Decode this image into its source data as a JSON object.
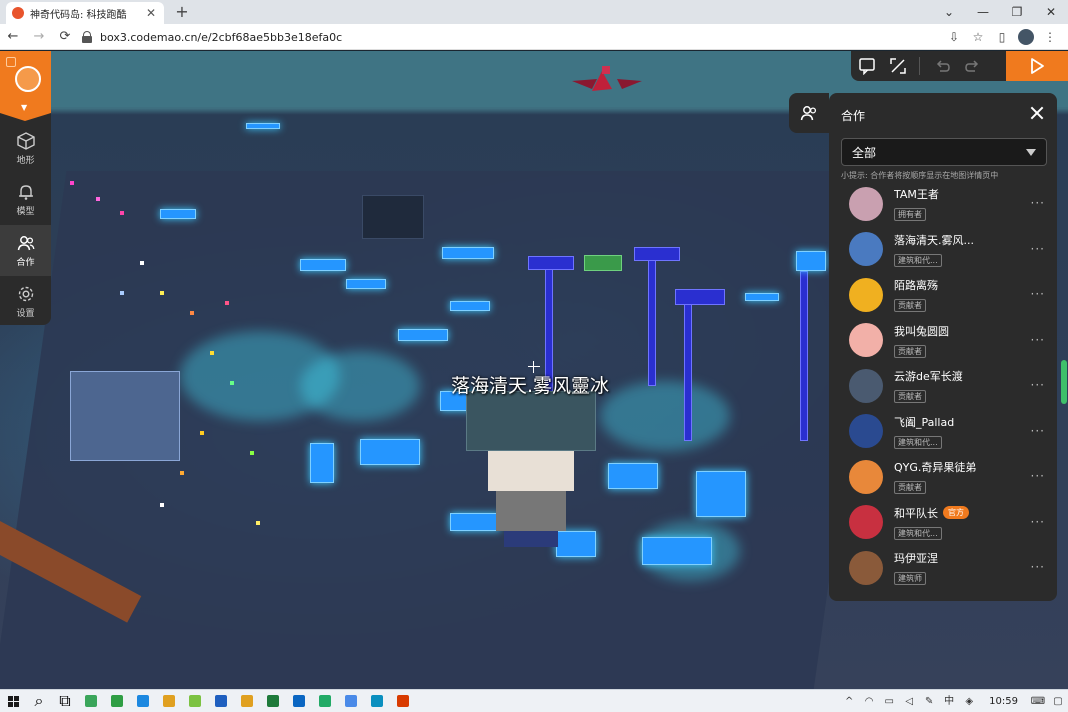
{
  "browser": {
    "tab_title": "神奇代码岛: 科技跑酷",
    "tab_close": "✕",
    "new_tab": "+",
    "url": "box3.codemao.cn/e/2cbf68ae5bb3e18efa0c",
    "window_controls": [
      "⌄",
      "—",
      "❐",
      "✕"
    ]
  },
  "left_bar": {
    "items": [
      {
        "label": "地形",
        "icon": "cube-icon"
      },
      {
        "label": "模型",
        "icon": "bell-icon"
      },
      {
        "label": "合作",
        "icon": "users-icon",
        "active": true
      },
      {
        "label": "设置",
        "icon": "gear-icon"
      }
    ]
  },
  "scene": {
    "player_name_tag": "落海清天.雾风靈冰"
  },
  "collab_panel": {
    "title": "合作",
    "filter_value": "全部",
    "hint": "小提示: 合作者将按顺序显示在地图详情页中",
    "members": [
      {
        "name": "TAM王者",
        "role": "拥有者",
        "avatar_color": "#c9a0b0"
      },
      {
        "name": "落海清天.雾风...",
        "role": "建筑和代...",
        "avatar_color": "#4a7ac0"
      },
      {
        "name": "陌路离殇",
        "role": "贡献者",
        "avatar_color": "#f0b020"
      },
      {
        "name": "我叫兔圆圆",
        "role": "贡献者",
        "avatar_color": "#f2b0a8"
      },
      {
        "name": "云游de军长渡",
        "role": "贡献者",
        "avatar_color": "#4a5a70"
      },
      {
        "name": "飞阖_Pallad",
        "role": "建筑和代...",
        "avatar_color": "#2a4a90"
      },
      {
        "name": "QYG.奇异果徒弟",
        "role": "贡献者",
        "avatar_color": "#e8883a"
      },
      {
        "name": "和平队长",
        "role": "建筑和代...",
        "avatar_color": "#c83040",
        "badge": "官方"
      },
      {
        "name": "玛伊亚涅",
        "role": "建筑师",
        "avatar_color": "#8a5a3a"
      }
    ],
    "more": "···"
  },
  "taskbar": {
    "clock": "10:59",
    "apps": [
      "#3aa55a",
      "#2f9e44",
      "#1c88e0",
      "#e0a020",
      "#7cc242",
      "#1f5fbf",
      "#e0a020",
      "#1e7a3a",
      "#0a66c2",
      "#22aa66",
      "#4a8ae8",
      "#0a8fbf",
      "#d83b01"
    ]
  },
  "colors": {
    "accent": "#f07a1e",
    "panel_bg": "#2b2b2b"
  }
}
